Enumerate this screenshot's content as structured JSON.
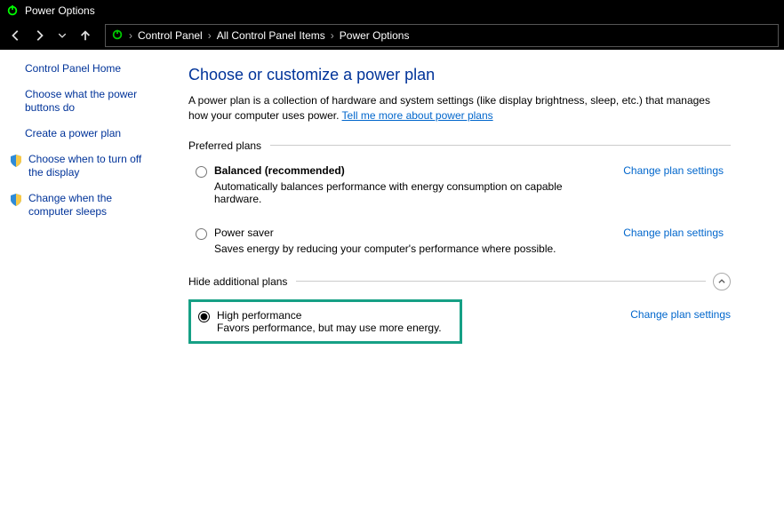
{
  "titlebar": {
    "title": "Power Options"
  },
  "breadcrumb": {
    "seg1": "Control Panel",
    "seg2": "All Control Panel Items",
    "seg3": "Power Options"
  },
  "sidebar": {
    "home": "Control Panel Home",
    "link1": "Choose what the power buttons do",
    "link2": "Create a power plan",
    "link3": "Choose when to turn off the display",
    "link4": "Change when the computer sleeps"
  },
  "main": {
    "heading": "Choose or customize a power plan",
    "intro_text": "A power plan is a collection of hardware and system settings (like display brightness, sleep, etc.) that manages how your computer uses power. ",
    "intro_link": "Tell me more about power plans",
    "preferred_label": "Preferred plans",
    "hide_label": "Hide additional plans",
    "change_settings": "Change plan settings",
    "plans": {
      "balanced": {
        "title": "Balanced (recommended)",
        "desc": "Automatically balances performance with energy consumption on capable hardware."
      },
      "saver": {
        "title": "Power saver",
        "desc": "Saves energy by reducing your computer's performance where possible."
      },
      "high": {
        "title": "High performance",
        "desc": "Favors performance, but may use more energy."
      }
    }
  }
}
